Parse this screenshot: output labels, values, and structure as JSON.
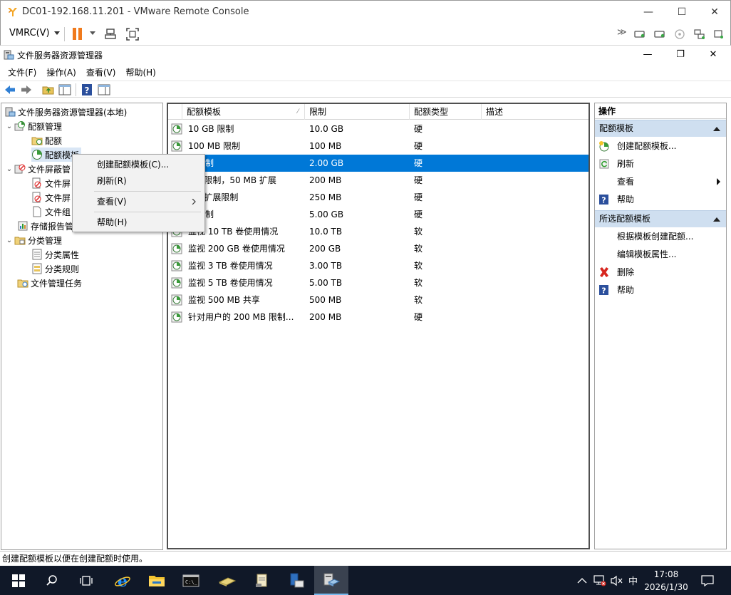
{
  "vmrc": {
    "title": "DC01-192.168.11.201 - VMware Remote Console",
    "menu_label": "VMRC(V)",
    "minimize": "—",
    "maximize": "☐",
    "close": "✕"
  },
  "mmc": {
    "title": "文件服务器资源管理器",
    "menus": [
      "文件(F)",
      "操作(A)",
      "查看(V)",
      "帮助(H)"
    ]
  },
  "tree": {
    "root": "文件服务器资源管理器(本地)",
    "quota_mgmt": "配额管理",
    "quotas": "配额",
    "quota_templates": "配额模板",
    "file_screen_mgmt": "文件屏蔽管",
    "file_screens": "文件屏",
    "file_screen_templates": "文件屏",
    "file_groups": "文件组",
    "storage_reports": "存储报告管",
    "classification_mgmt": "分类管理",
    "class_props": "分类属性",
    "class_rules": "分类规则",
    "file_mgmt_tasks": "文件管理任务"
  },
  "list": {
    "headers": [
      "配额模板",
      "限制",
      "配额类型",
      "描述"
    ],
    "rows": [
      {
        "name": "10 GB 限制",
        "limit": "10.0 GB",
        "type": "硬",
        "desc": ""
      },
      {
        "name": "100 MB 限制",
        "limit": "100 MB",
        "type": "硬",
        "desc": ""
      },
      {
        "name": "B 限制",
        "limit": "2.00 GB",
        "type": "硬",
        "desc": ""
      },
      {
        "name": "MB 限制，50 MB 扩展",
        "limit": "200 MB",
        "type": "硬",
        "desc": ""
      },
      {
        "name": "MB 扩展限制",
        "limit": "250 MB",
        "type": "硬",
        "desc": ""
      },
      {
        "name": "B 限制",
        "limit": "5.00 GB",
        "type": "硬",
        "desc": ""
      },
      {
        "name": "监视 10 TB 卷使用情况",
        "limit": "10.0 TB",
        "type": "软",
        "desc": ""
      },
      {
        "name": "监视 200 GB 卷使用情况",
        "limit": "200 GB",
        "type": "软",
        "desc": ""
      },
      {
        "name": "监视 3 TB 卷使用情况",
        "limit": "3.00 TB",
        "type": "软",
        "desc": ""
      },
      {
        "name": "监视 5 TB 卷使用情况",
        "limit": "5.00 TB",
        "type": "软",
        "desc": ""
      },
      {
        "name": "监视 500 MB 共享",
        "limit": "500 MB",
        "type": "软",
        "desc": ""
      },
      {
        "name": "针对用户的 200 MB 限制...",
        "limit": "200 MB",
        "type": "硬",
        "desc": ""
      }
    ]
  },
  "actions": {
    "header": "操作",
    "section1": "配额模板",
    "create_template": "创建配额模板...",
    "refresh": "刷新",
    "view": "查看",
    "help": "帮助",
    "section2": "所选配额模板",
    "create_from_template": "根据模板创建配额...",
    "edit_props": "编辑模板属性...",
    "delete": "删除",
    "help2": "帮助"
  },
  "context_menu": {
    "create": "创建配额模板(C)...",
    "refresh": "刷新(R)",
    "view": "查看(V)",
    "help": "帮助(H)"
  },
  "status": "创建配额模板以便在创建配额时使用。",
  "taskbar": {
    "ime": "中",
    "time": "17:08",
    "date": "2026/1/30"
  },
  "colors": {
    "selection": "#0078d7",
    "action_section": "#cfdff0",
    "taskbar": "#101828",
    "pause": "#f07a1c"
  }
}
